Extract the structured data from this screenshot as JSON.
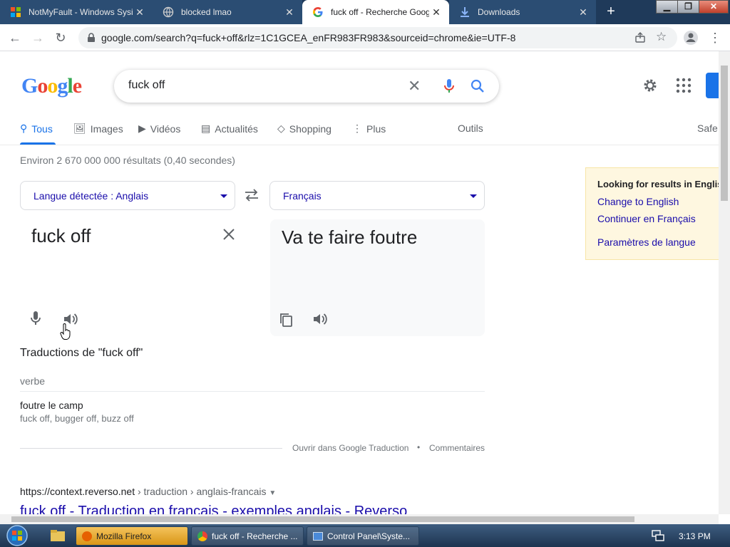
{
  "browser": {
    "tabs": [
      {
        "title": "NotMyFault - Windows Sysint"
      },
      {
        "title": "blocked lmao"
      },
      {
        "title": "fuck off - Recherche Google"
      },
      {
        "title": "Downloads"
      }
    ],
    "url": "google.com/search?q=fuck+off&rlz=1C1GCEA_enFR983FR983&sourceid=chrome&ie=UTF-8"
  },
  "google": {
    "query": "fuck off",
    "nav": [
      "Tous",
      "Images",
      "Vidéos",
      "Actualités",
      "Shopping",
      "Plus"
    ],
    "tools": "Outils",
    "safe": "Safe",
    "stats": "Environ 2 670 000 000 résultats (0,40 secondes)"
  },
  "translate": {
    "source_lang": "Langue détectée : Anglais",
    "target_lang": "Français",
    "source_text": "fuck off",
    "target_text": "Va te faire foutre",
    "heading": "Traductions de \"fuck off\"",
    "pos": "verbe",
    "translation": "foutre le camp",
    "synonyms": "fuck off, bugger off, buzz off",
    "open_link": "Ouvrir dans Google Traduction",
    "dot": "•",
    "comments": "Commentaires"
  },
  "result": {
    "cite_domain": "https://context.reverso.net",
    "cite_path": " › traduction › anglais-francais",
    "title": "fuck off - Traduction en français - exemples anglais - Reverso"
  },
  "lang_card": {
    "heading": "Looking for results in English?",
    "change": "Change to English",
    "continue": "Continuer en Français",
    "settings": "Paramètres de langue"
  },
  "taskbar": {
    "firefox": "Mozilla Firefox",
    "chrome": "fuck off - Recherche ...",
    "control_panel": "Control Panel\\Syste...",
    "clock": "3:13 PM"
  }
}
